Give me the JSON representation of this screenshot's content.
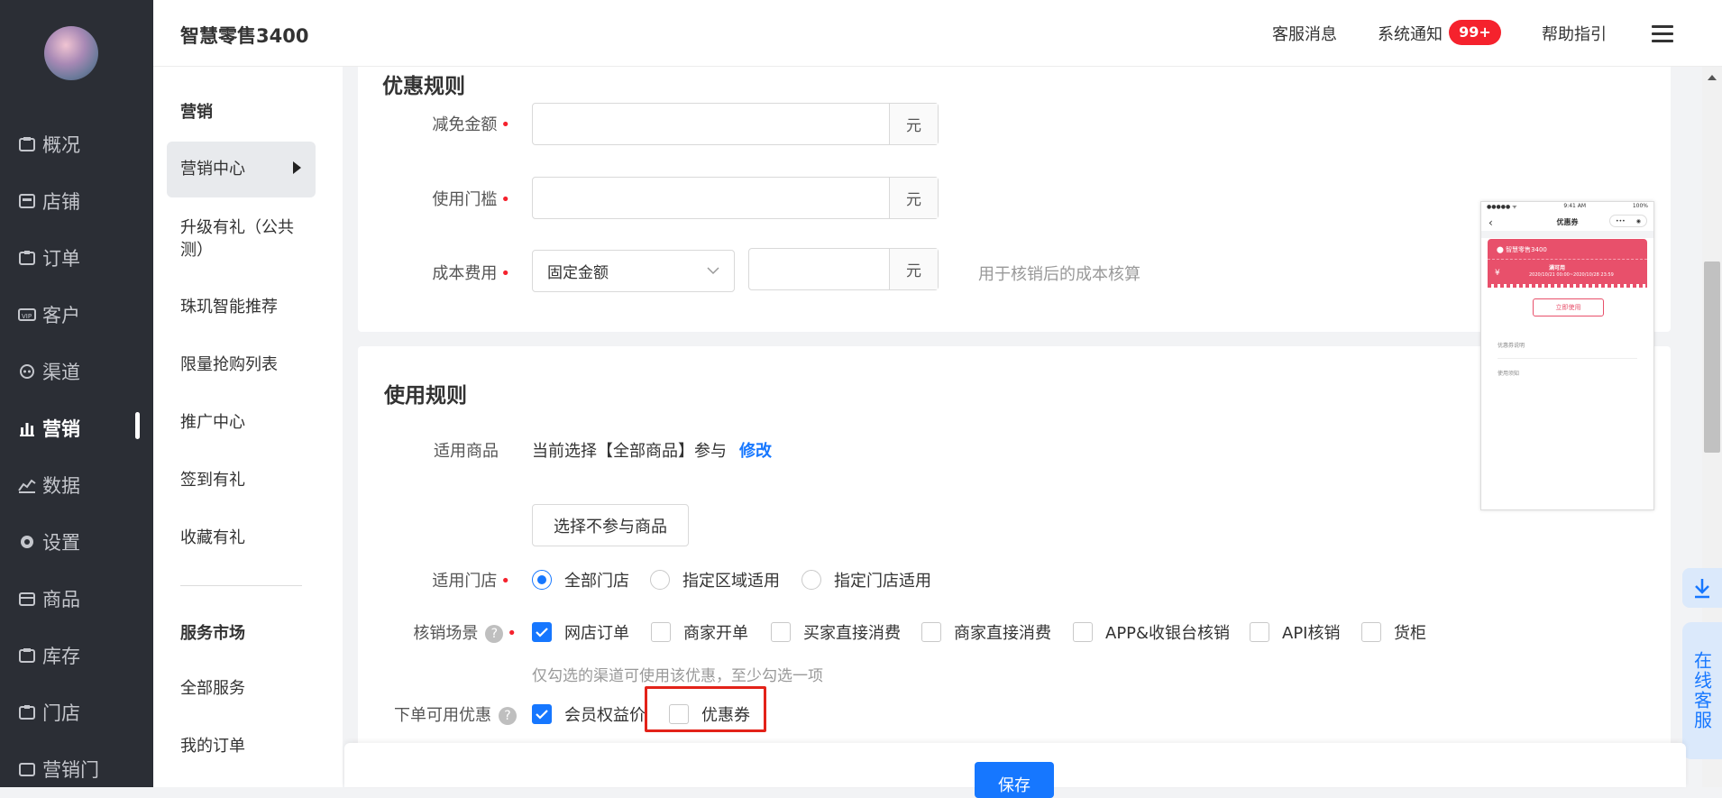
{
  "topbar": {
    "brand": "智慧零售3400",
    "service_msg": "客服消息",
    "sys_notice": "系统通知",
    "notice_badge": "99+",
    "help": "帮助指引"
  },
  "nav": {
    "items": [
      {
        "label": "概况",
        "icon": "dashboard-icon"
      },
      {
        "label": "店铺",
        "icon": "store-icon"
      },
      {
        "label": "订单",
        "icon": "order-icon"
      },
      {
        "label": "客户",
        "icon": "vip-icon"
      },
      {
        "label": "渠道",
        "icon": "channel-icon"
      },
      {
        "label": "营销",
        "icon": "marketing-icon"
      },
      {
        "label": "数据",
        "icon": "chart-icon"
      },
      {
        "label": "设置",
        "icon": "gear-icon"
      },
      {
        "label": "商品",
        "icon": "goods-icon"
      },
      {
        "label": "库存",
        "icon": "inventory-icon"
      },
      {
        "label": "门店",
        "icon": "shop-icon"
      },
      {
        "label": "营销门",
        "icon": "marketing-door-icon"
      }
    ],
    "active": "营销"
  },
  "subnav": {
    "head": "营销",
    "items": [
      "营销中心",
      "升级有礼（公共测）",
      "珠玑智能推荐",
      "限量抢购列表",
      "推广中心",
      "签到有礼",
      "收藏有礼"
    ],
    "active": "营销中心",
    "service_head": "服务市场",
    "service_items": [
      "全部服务",
      "我的订单"
    ]
  },
  "discount": {
    "title_partial": "优惠规则",
    "amount_label": "减免金额",
    "amount_value": "",
    "threshold_label": "使用门槛",
    "threshold_value": "",
    "cost_label": "成本费用",
    "cost_type": "固定金额",
    "cost_value": "",
    "cost_hint": "用于核销后的成本核算",
    "unit": "元"
  },
  "usage": {
    "title": "使用规则",
    "goods_label": "适用商品",
    "goods_text": "当前选择【全部商品】参与",
    "goods_edit": "修改",
    "exclude_btn": "选择不参与商品",
    "store_label": "适用门店",
    "store_options": [
      {
        "label": "全部门店",
        "checked": true
      },
      {
        "label": "指定区域适用",
        "checked": false
      },
      {
        "label": "指定门店适用",
        "checked": false
      }
    ],
    "scene_label": "核销场景",
    "scene_options": [
      {
        "label": "网店订单",
        "checked": true
      },
      {
        "label": "商家开单",
        "checked": false
      },
      {
        "label": "买家直接消费",
        "checked": false
      },
      {
        "label": "商家直接消费",
        "checked": false
      },
      {
        "label": "APP&收银台核销",
        "checked": false
      },
      {
        "label": "API核销",
        "checked": false
      },
      {
        "label": "货柜",
        "checked": false
      }
    ],
    "scene_hint": "仅勾选的渠道可使用该优惠，至少勾选一项",
    "order_label": "下单可用优惠",
    "order_options": [
      {
        "label": "会员权益价",
        "checked": true
      },
      {
        "label": "优惠券",
        "checked": false
      }
    ]
  },
  "preview": {
    "time": "9:41 AM",
    "battery": "100%",
    "title": "优惠券",
    "shop": "智慧零售3400",
    "coupon_type": "满可用",
    "coupon_date": "2020/10/21 00:00~2020/10/28 23:59",
    "use_btn": "立即使用",
    "row1": "优惠券说明",
    "row2": "使用须知"
  },
  "floating": {
    "online_service": "在线客服"
  },
  "footer": {
    "save": "保存"
  },
  "colors": {
    "primary": "#1677ff",
    "danger": "#f5222d",
    "nav_bg": "#2b2e35"
  }
}
